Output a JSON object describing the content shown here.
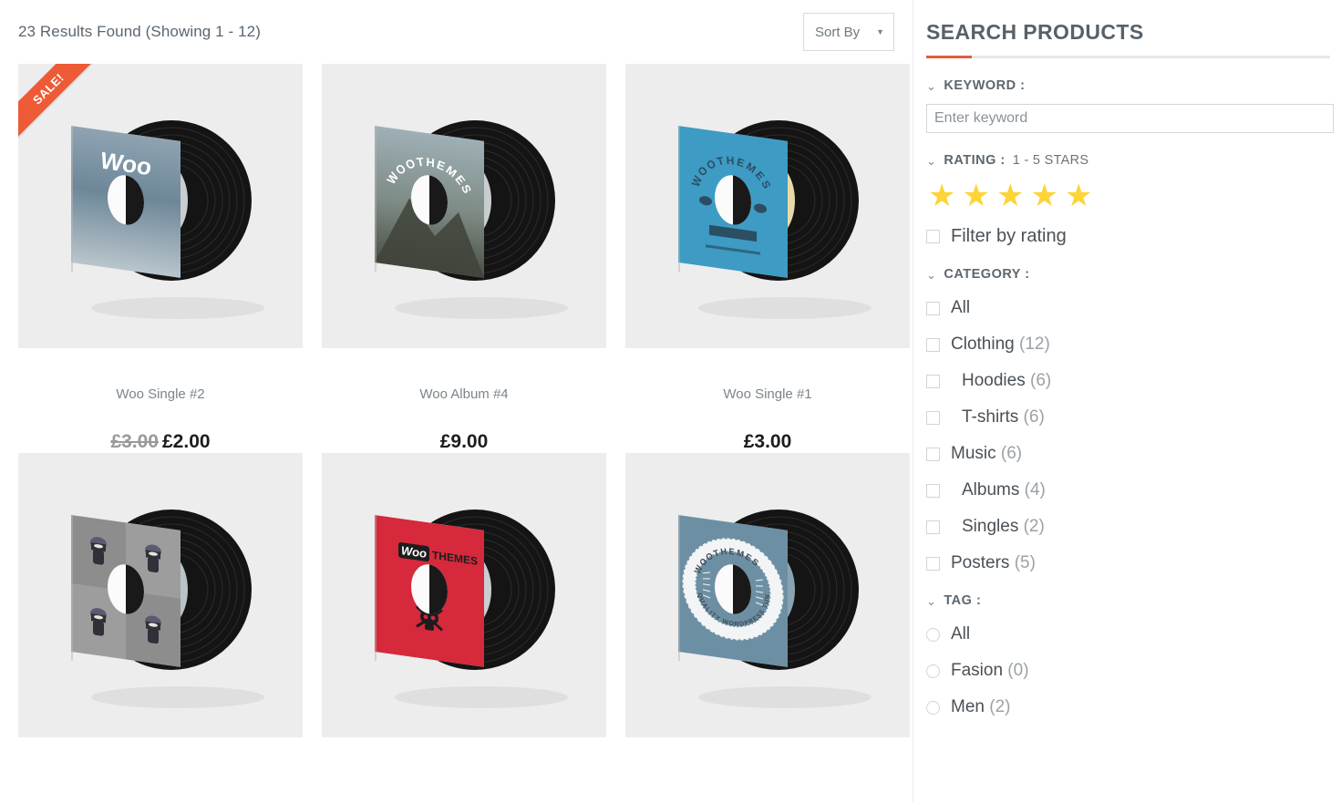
{
  "results": {
    "count_text": "23 Results Found (Showing 1 - 12)",
    "sort_label": "Sort By",
    "sort_caret": "chevron-down"
  },
  "products": [
    {
      "title": "Woo Single #2",
      "price": "£2.00",
      "old_price": "£3.00",
      "on_sale": true,
      "sale_label": "SALE!",
      "sleeve_color": "#6f8494",
      "label_color": "#c9cdd0",
      "artwork": "woo-sky"
    },
    {
      "title": "Woo Album #4",
      "price": "£9.00",
      "old_price": "",
      "on_sale": false,
      "sale_label": "",
      "sleeve_color": "#9aa49c",
      "label_color": "#c9cdd0",
      "artwork": "woothemes-circle-photo"
    },
    {
      "title": "Woo Single #1",
      "price": "£3.00",
      "old_price": "",
      "on_sale": false,
      "sale_label": "",
      "sleeve_color": "#3d9bc4",
      "label_color": "#e8d9a8",
      "artwork": "woothemes-blue"
    },
    {
      "title": "",
      "price": "",
      "old_price": "",
      "on_sale": false,
      "sale_label": "",
      "sleeve_color": "#9d9d9d",
      "label_color": "#b9c3c9",
      "artwork": "ninja-grid"
    },
    {
      "title": "",
      "price": "",
      "old_price": "",
      "on_sale": false,
      "sale_label": "",
      "sleeve_color": "#d6293c",
      "label_color": "#c9cdd0",
      "artwork": "woothemes-red-skull"
    },
    {
      "title": "",
      "price": "",
      "old_price": "",
      "on_sale": false,
      "sale_label": "",
      "sleeve_color": "#6d8fa3",
      "label_color": "#8aa3b2",
      "artwork": "woothemes-tunes"
    }
  ],
  "sidebar": {
    "title": "SEARCH PRODUCTS",
    "accent_color": "#e05d40",
    "keyword": {
      "heading": "KEYWORD :",
      "placeholder": "Enter keyword",
      "value": ""
    },
    "rating": {
      "heading": "RATING :",
      "heading_suffix": "1 - 5 STARS",
      "stars_filled": 5,
      "star_color": "#fcd437",
      "filter_label": "Filter by rating",
      "filter_checked": false
    },
    "category": {
      "heading": "CATEGORY :",
      "items": [
        {
          "label": "All",
          "count": "",
          "sub": false,
          "checked": false
        },
        {
          "label": "Clothing",
          "count": "(12)",
          "sub": false,
          "checked": false
        },
        {
          "label": "Hoodies",
          "count": "(6)",
          "sub": true,
          "checked": false
        },
        {
          "label": "T-shirts",
          "count": "(6)",
          "sub": true,
          "checked": false
        },
        {
          "label": "Music",
          "count": "(6)",
          "sub": false,
          "checked": false
        },
        {
          "label": "Albums",
          "count": "(4)",
          "sub": true,
          "checked": false
        },
        {
          "label": "Singles",
          "count": "(2)",
          "sub": true,
          "checked": false
        },
        {
          "label": "Posters",
          "count": "(5)",
          "sub": false,
          "checked": false
        }
      ]
    },
    "tag": {
      "heading": "TAG :",
      "items": [
        {
          "label": "All",
          "count": "",
          "checked": false
        },
        {
          "label": "Fasion",
          "count": "(0)",
          "checked": false
        },
        {
          "label": "Men",
          "count": "(2)",
          "checked": false
        }
      ]
    }
  }
}
